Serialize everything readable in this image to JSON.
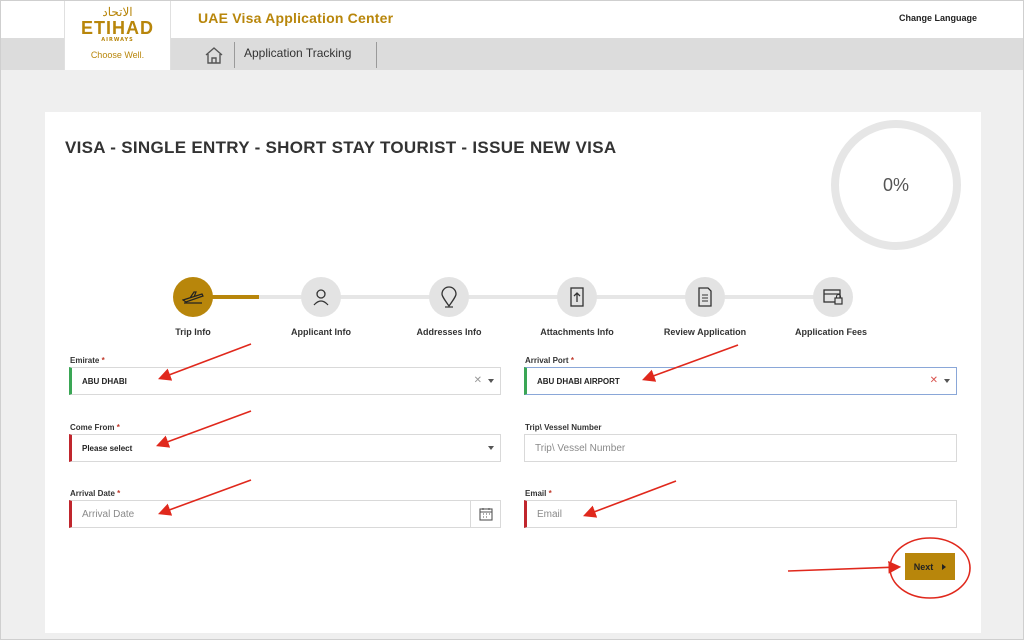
{
  "header": {
    "app_title": "UAE Visa Application Center",
    "change_language": "Change Language",
    "logo": {
      "arabic": "الاتحاد",
      "main": "ETIHAD",
      "sub": "AIRWAYS",
      "slogan": "Choose Well."
    }
  },
  "nav": {
    "home_icon": "home-icon",
    "tab_label": "Application Tracking"
  },
  "page": {
    "title": "VISA - SINGLE ENTRY - SHORT STAY TOURIST - ISSUE NEW VISA",
    "progress": "0%"
  },
  "steps": [
    {
      "label": "Trip Info",
      "icon": "airplane-icon",
      "active": true
    },
    {
      "label": "Applicant Info",
      "icon": "person-icon",
      "active": false
    },
    {
      "label": "Addresses Info",
      "icon": "location-pin-icon",
      "active": false
    },
    {
      "label": "Attachments Info",
      "icon": "upload-file-icon",
      "active": false
    },
    {
      "label": "Review Application",
      "icon": "document-icon",
      "active": false
    },
    {
      "label": "Application Fees",
      "icon": "payment-lock-icon",
      "active": false
    }
  ],
  "form": {
    "emirate": {
      "label": "Emirate",
      "value": "ABU DHABI"
    },
    "arrival_port": {
      "label": "Arrival Port",
      "value": "ABU DHABI AIRPORT"
    },
    "come_from": {
      "label": "Come From",
      "value": "Please select"
    },
    "vessel": {
      "label": "Trip\\ Vessel Number",
      "placeholder": "Trip\\ Vessel Number"
    },
    "arrival_date": {
      "label": "Arrival Date",
      "placeholder": "Arrival Date"
    },
    "email": {
      "label": "Email",
      "placeholder": "Email"
    },
    "required_mark": "*"
  },
  "actions": {
    "next_label": "Next"
  },
  "colors": {
    "brand_gold": "#b8860b",
    "annotation_red": "#e0281c",
    "valid_green": "#3aa655",
    "invalid_red": "#c0262d"
  }
}
